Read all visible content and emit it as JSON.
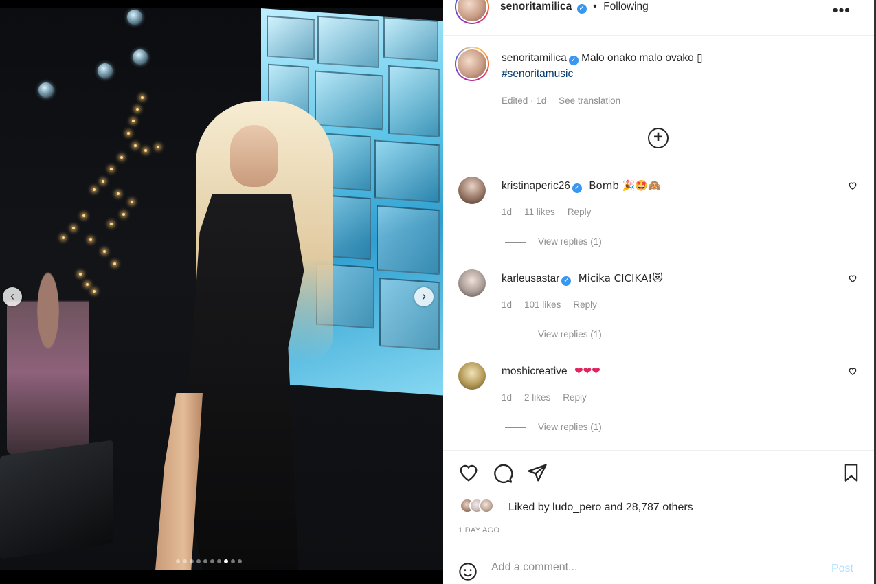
{
  "post": {
    "header": {
      "username": "senoritamilica",
      "separator": "•",
      "following_label": "Following",
      "more_label": "•••"
    },
    "caption": {
      "username": "senoritamilica",
      "text": "Malo onako malo ovako ▯",
      "hashtag": "#senoritamusic",
      "edited": "Edited · 1d",
      "see_translation": "See translation"
    },
    "load_more_label": "+",
    "comments": [
      {
        "username": "kristinaperic26",
        "verified": true,
        "text": "Bomb 🎉🤩🙈",
        "age": "1d",
        "likes": "11 likes",
        "reply": "Reply",
        "view_replies": "View replies (1)"
      },
      {
        "username": "karleusastar",
        "verified": true,
        "text": "Micika CICIKA!😻",
        "age": "1d",
        "likes": "101 likes",
        "reply": "Reply",
        "view_replies": "View replies (1)"
      },
      {
        "username": "moshicreative",
        "verified": false,
        "text": "❤❤❤",
        "age": "1d",
        "likes": "2 likes",
        "reply": "Reply",
        "view_replies": "View replies (1)"
      }
    ],
    "liked_by": {
      "prefix": "Liked by",
      "user": "ludo_pero",
      "and": "and",
      "others": "28,787 others"
    },
    "timestamp": "1 DAY AGO",
    "comment_input": {
      "placeholder": "Add a comment...",
      "post_label": "Post"
    },
    "carousel": {
      "total": 10,
      "active_index": 7
    }
  },
  "icons": [
    "like-icon",
    "comment-icon",
    "share-icon",
    "bookmark-icon",
    "emoji-icon",
    "heart-icon",
    "verified-icon",
    "add-circle-icon",
    "chevron-left-icon",
    "chevron-right-icon"
  ],
  "colors": {
    "link": "#00376b",
    "verified": "#3897f0",
    "post_button": "#b2dffc",
    "muted": "#8e8e8e"
  }
}
